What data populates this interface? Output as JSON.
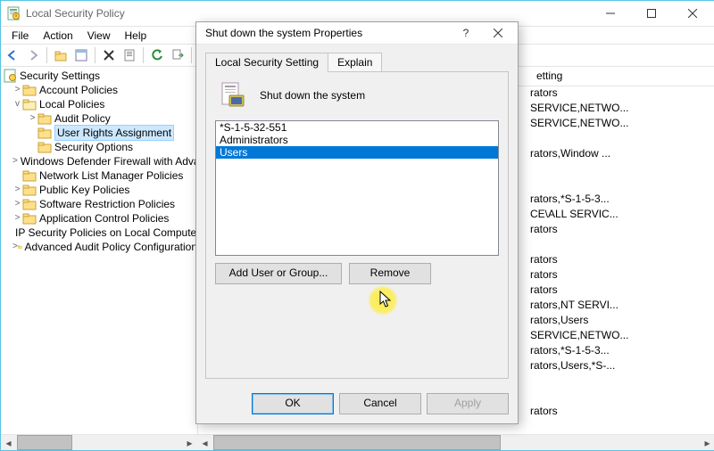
{
  "window": {
    "title": "Local Security Policy",
    "menu": [
      "File",
      "Action",
      "View",
      "Help"
    ]
  },
  "toolbar_icons": [
    "back",
    "forward",
    "up",
    "props-sheet",
    "delete",
    "refresh",
    "export",
    "help",
    "grid"
  ],
  "tree": {
    "root_label": "Security Settings",
    "nodes": [
      {
        "label": "Account Policies",
        "depth": 1,
        "expander": ">",
        "icon": "folder"
      },
      {
        "label": "Local Policies",
        "depth": 1,
        "expander": "v",
        "icon": "folder"
      },
      {
        "label": "Audit Policy",
        "depth": 2,
        "expander": ">",
        "icon": "folder"
      },
      {
        "label": "User Rights Assignment",
        "depth": 2,
        "expander": "",
        "icon": "folder",
        "selected": true
      },
      {
        "label": "Security Options",
        "depth": 2,
        "expander": "",
        "icon": "folder"
      },
      {
        "label": "Windows Defender Firewall with Advanced Security",
        "depth": 1,
        "expander": ">",
        "icon": "folder"
      },
      {
        "label": "Network List Manager Policies",
        "depth": 1,
        "expander": "",
        "icon": "folder"
      },
      {
        "label": "Public Key Policies",
        "depth": 1,
        "expander": ">",
        "icon": "folder"
      },
      {
        "label": "Software Restriction Policies",
        "depth": 1,
        "expander": ">",
        "icon": "folder"
      },
      {
        "label": "Application Control Policies",
        "depth": 1,
        "expander": ">",
        "icon": "folder"
      },
      {
        "label": "IP Security Policies on Local Computer",
        "depth": 1,
        "expander": "",
        "icon": "ipsec"
      },
      {
        "label": "Advanced Audit Policy Configuration",
        "depth": 1,
        "expander": ">",
        "icon": "folder"
      }
    ]
  },
  "list": {
    "col2_header": "etting",
    "rows_col2": [
      "rators",
      "SERVICE,NETWO...",
      "SERVICE,NETWO...",
      "",
      "rators,Window ...",
      "",
      "",
      "rators,*S-1-5-3...",
      "CE\\ALL SERVIC...",
      "rators",
      "",
      "rators",
      "rators",
      "rators",
      "rators,NT SERVI...",
      "rators,Users",
      "SERVICE,NETWO...",
      "rators,*S-1-5-3...",
      "rators,Users,*S-...",
      "",
      "",
      "rators"
    ]
  },
  "dialog": {
    "title": "Shut down the system Properties",
    "tabs": {
      "t1": "Local Security Setting",
      "t2": "Explain"
    },
    "policy_label": "Shut down the system",
    "list_items": [
      "*S-1-5-32-551",
      "Administrators",
      "Users"
    ],
    "selected_index": 2,
    "add_btn": "Add User or Group...",
    "remove_btn": "Remove",
    "ok": "OK",
    "cancel": "Cancel",
    "apply": "Apply"
  }
}
